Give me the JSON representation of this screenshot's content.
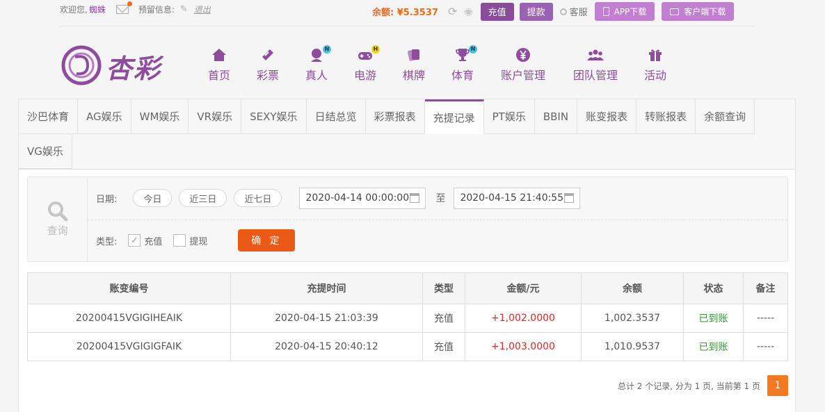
{
  "topbar": {
    "welcome": "欢迎您,",
    "username": "蜘蛛",
    "reserved_label": "预留信息:",
    "logout": "退出",
    "balance": "余额: ¥5.3537",
    "deposit": "充值",
    "withdraw": "提款",
    "service": "客服",
    "app_download": "APP下载",
    "client_download": "客户端下载"
  },
  "logo": {
    "text": "杏彩"
  },
  "nav": [
    {
      "label": "首页"
    },
    {
      "label": "彩票"
    },
    {
      "label": "真人",
      "badge": "N"
    },
    {
      "label": "电游",
      "badge": "H"
    },
    {
      "label": "棋牌"
    },
    {
      "label": "体育",
      "badge": "N"
    },
    {
      "label": "账户管理"
    },
    {
      "label": "团队管理"
    },
    {
      "label": "活动"
    }
  ],
  "tabs": [
    "沙巴体育",
    "AG娱乐",
    "WM娱乐",
    "VR娱乐",
    "SEXY娱乐",
    "日结总览",
    "彩票报表",
    "充提记录",
    "PT娱乐",
    "BBIN",
    "账变报表",
    "转账报表",
    "余额查询",
    "VG娱乐"
  ],
  "search": {
    "side_label": "查询",
    "date_label": "日期:",
    "quick": [
      "今日",
      "近三日",
      "近七日"
    ],
    "start": "2020-04-14 00:00:00",
    "to": "至",
    "end": "2020-04-15 21:40:55",
    "type_label": "类型:",
    "type_deposit": "充值",
    "type_withdraw": "提现",
    "confirm": "确 定"
  },
  "table": {
    "headers": [
      "账变编号",
      "充提时间",
      "类型",
      "金额/元",
      "余额",
      "状态",
      "备注"
    ],
    "rows": [
      [
        "20200415VGIGIHEAIK",
        "2020-04-15 21:03:39",
        "充值",
        "+1,002.0000",
        "1,002.3537",
        "已到账",
        "-----"
      ],
      [
        "20200415VGIGIGFAIK",
        "2020-04-15 20:40:12",
        "充值",
        "+1,003.0000",
        "1,010.9537",
        "已到账",
        "-----"
      ]
    ]
  },
  "pager": {
    "summary": "总计 2 个记录, 分为 1 页, 当前第 1 页",
    "page": "1"
  }
}
